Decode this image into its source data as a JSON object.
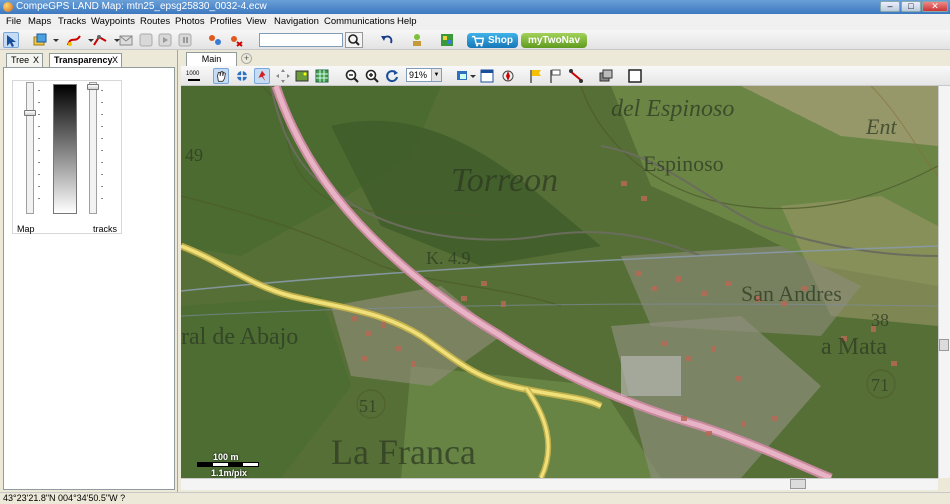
{
  "window": {
    "title": "CompeGPS LAND Map: mtn25_epsg25830_0032-4.ecw",
    "controls": [
      "–",
      "□",
      "✕"
    ]
  },
  "menu": [
    "File",
    "Maps",
    "Tracks",
    "Waypoints",
    "Routes",
    "Photos",
    "Profiles",
    "View",
    "Navigation",
    "Communications",
    "Help"
  ],
  "toolbar": {
    "search_value": "",
    "shop_label": "Shop",
    "mytwonav_label": "myTwoNav"
  },
  "left_panel": {
    "tabs": [
      {
        "label": "Tree",
        "close": "X"
      },
      {
        "label": "Transparency",
        "close": "X"
      }
    ],
    "transparency": {
      "left_label": "Map",
      "right_label": "tracks"
    }
  },
  "map_window": {
    "tab_label": "Main window",
    "add_tab": "+",
    "zoom_value": "91%"
  },
  "map": {
    "labels": [
      "Torreon",
      "Espinoso",
      "del Espinoso",
      "K. 4.9",
      "ral de Abajo",
      "La Franca",
      "a Mata",
      "San Andres",
      "38",
      "71",
      "51",
      "49",
      "Ent"
    ],
    "scale_top": "100 m",
    "scale_bottom": "1.1m/pix"
  },
  "status": {
    "coordinates": "43°23'21.8\"N 004°34'50.5\"W",
    "extra": "?"
  },
  "colors": {
    "titlebar": "#3d78c0",
    "shop": "#1677b8",
    "mytwonav": "#5f9a1f",
    "road": "#d9a0b4",
    "track": "#e6d25a"
  }
}
